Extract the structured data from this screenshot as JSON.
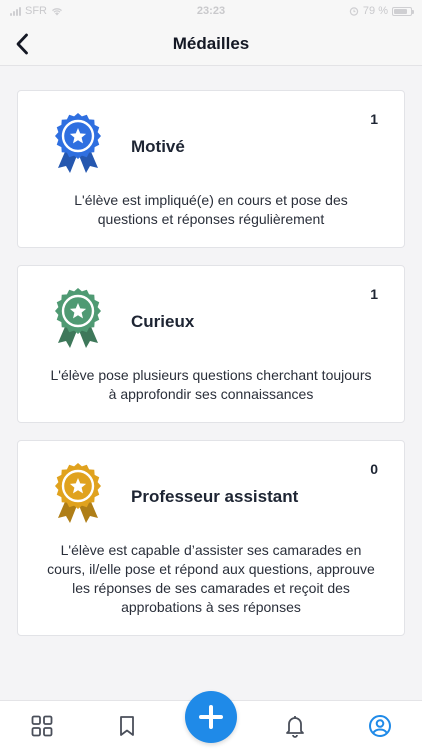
{
  "status_bar": {
    "carrier": "SFR",
    "time": "23:23",
    "battery": "79 %",
    "battery_level": 0.79
  },
  "header": {
    "title": "Médailles",
    "back_icon": "chevron-left-icon"
  },
  "medals": [
    {
      "title": "Motivé",
      "count": "1",
      "description": "L'élève est impliqué(e) en cours et pose des questions et réponses régulièrement",
      "color": "#2f6fe0",
      "icon": "medal-star-icon"
    },
    {
      "title": "Curieux",
      "count": "1",
      "description": "L'élève pose plusieurs questions cherchant toujours à approfondir ses connaissances",
      "color": "#4f9a73",
      "icon": "medal-star-icon"
    },
    {
      "title": "Professeur assistant",
      "count": "0",
      "description": "L'élève est capable d’assister ses camarades en cours, il/elle pose et répond aux questions, approuve les réponses de ses camarades et reçoit des approbations à ses réponses",
      "color": "#e0a21e",
      "icon": "medal-star-icon"
    }
  ],
  "bottom_nav": {
    "items": [
      "grid-icon",
      "bookmark-icon",
      "plus-icon",
      "bell-icon",
      "profile-icon"
    ],
    "fab_color": "#1f8ae8",
    "active_color": "#1f8ae8"
  }
}
